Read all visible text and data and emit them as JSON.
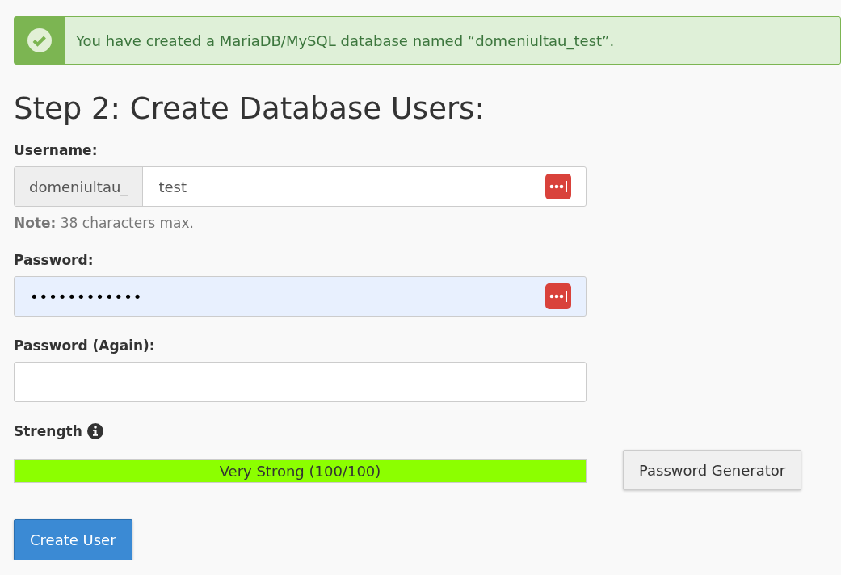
{
  "alert": {
    "kind": "success",
    "message": "You have created a MariaDB/MySQL database named “domeniultau_test”."
  },
  "heading": "Step 2: Create Database Users:",
  "username": {
    "label": "Username:",
    "prefix": "domeniultau_",
    "value": "test",
    "note": "**Note:** 38 characters max."
  },
  "password": {
    "label": "Password:",
    "value": "••••••••••••",
    "autofilled": true
  },
  "password_again": {
    "label": "Password (Again):",
    "autofilled": false
  },
  "strength": {
    "label": "Strength",
    "level": 1,
    "reading": "Very Strong (100/100)"
  },
  "buttons": [
    {
      "label": "Password Generator",
      "kind": "default"
    },
    {
      "label": "Create User",
      "kind": "primary"
    }
  ]
}
